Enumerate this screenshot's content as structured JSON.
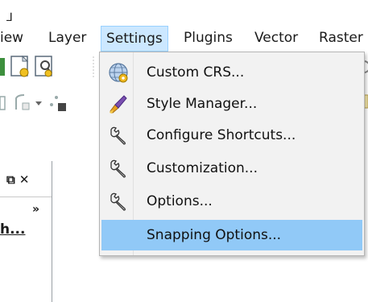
{
  "top_glyph": "⅃",
  "menubar": {
    "items": [
      {
        "label": "iew"
      },
      {
        "label": "Layer"
      },
      {
        "label": "Settings"
      },
      {
        "label": "Plugins"
      },
      {
        "label": "Vector"
      },
      {
        "label": "Raster"
      }
    ]
  },
  "panel": {
    "controls": "⧉ ✕",
    "chevron": "»",
    "text": "h..."
  },
  "settings_menu": {
    "items": [
      {
        "label": "Custom CRS...",
        "icon": "globe-crs-icon"
      },
      {
        "label": "Style Manager...",
        "icon": "paintbrush-icon"
      },
      {
        "label": "Configure Shortcuts...",
        "icon": "wrench-icon"
      },
      {
        "label": "Customization...",
        "icon": "wrench-icon"
      },
      {
        "label": "Options...",
        "icon": "wrench-icon"
      },
      {
        "label": "Snapping Options...",
        "icon": "none",
        "highlighted": true
      }
    ]
  },
  "colors": {
    "menu_active_bg": "#cce8ff",
    "item_highlight_bg": "#91c9f7",
    "dropdown_bg": "#f2f2f2"
  }
}
